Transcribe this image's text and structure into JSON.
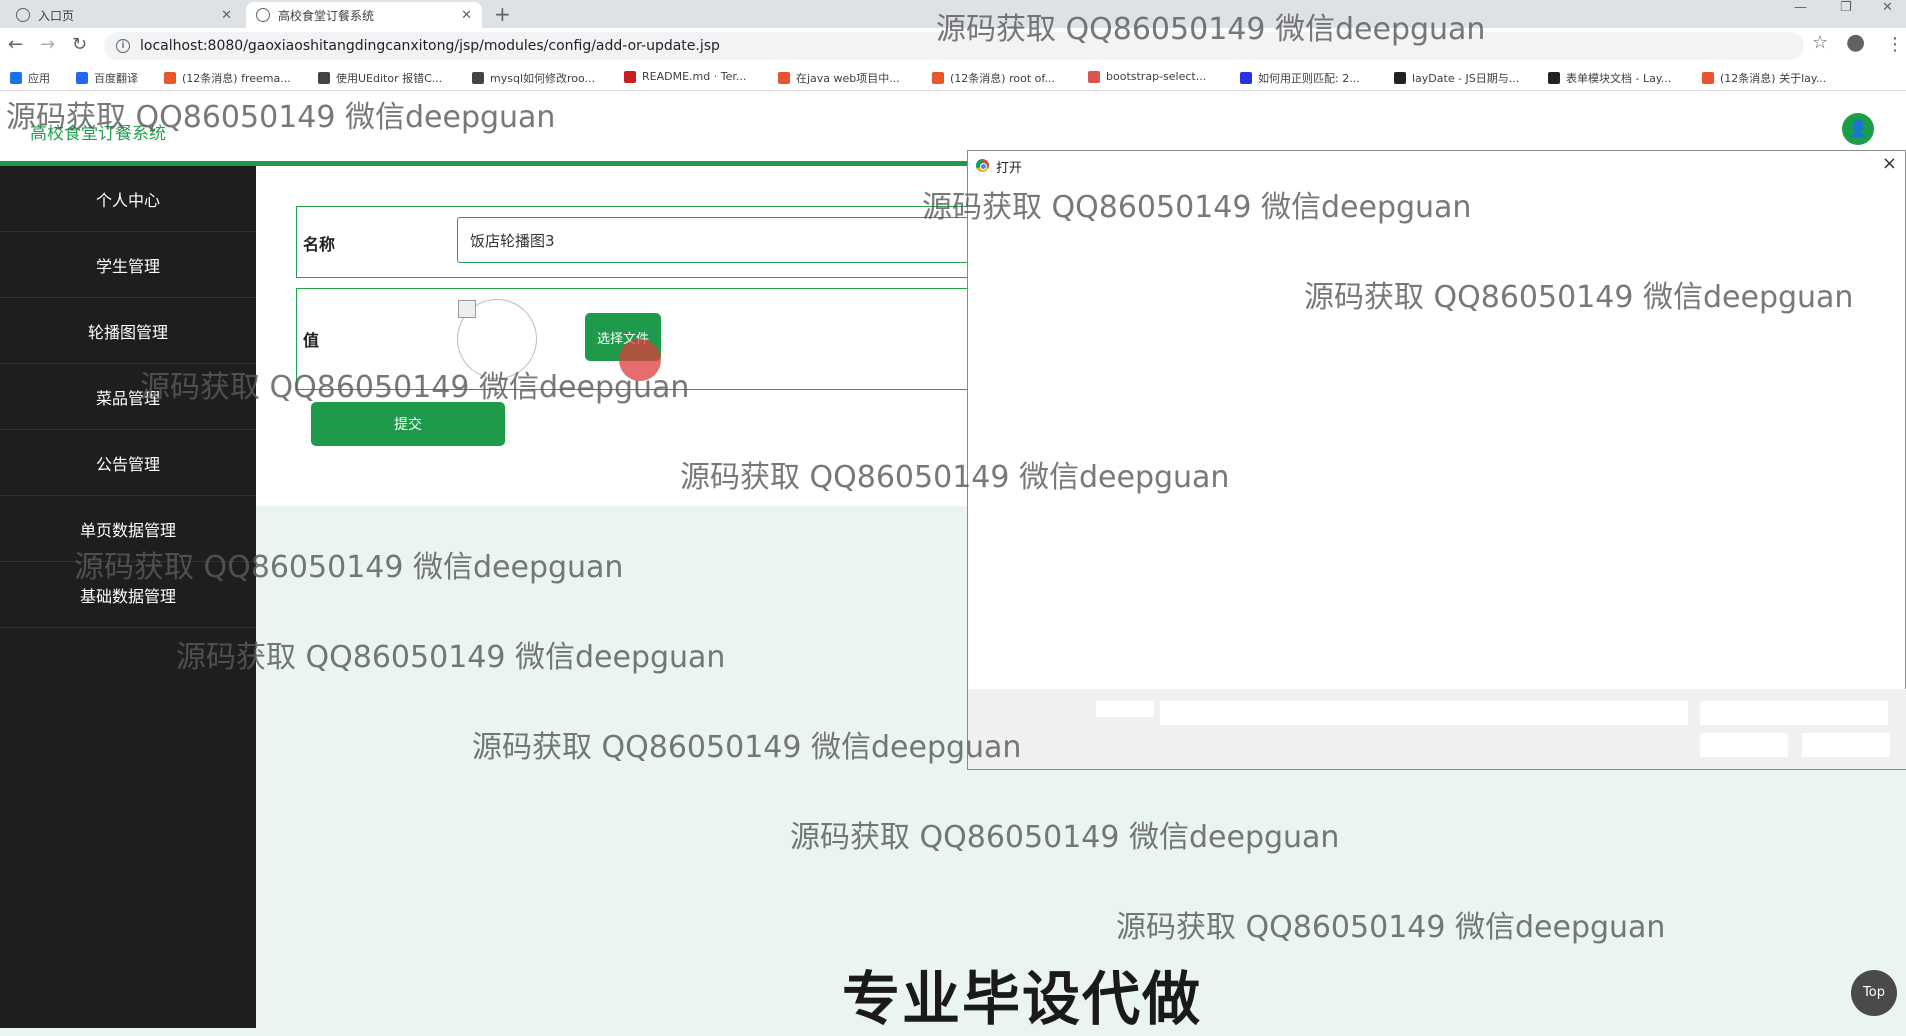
{
  "browser": {
    "tabs": [
      {
        "label": "入口页"
      },
      {
        "label": "高校食堂订餐系统"
      }
    ],
    "url": "localhost:8080/gaoxiaoshitangdingcanxitong/jsp/modules/config/add-or-update.jsp",
    "bookmarks": [
      {
        "label": "应用",
        "color": "#1a73e8"
      },
      {
        "label": "百度翻译",
        "color": "#2468f2"
      },
      {
        "label": "(12条消息) freema...",
        "color": "#e8542c"
      },
      {
        "label": "使用UEditor 报错C...",
        "color": "#444444"
      },
      {
        "label": "mysql如何修改roo...",
        "color": "#444444"
      },
      {
        "label": "README.md · Ter...",
        "color": "#c71d23"
      },
      {
        "label": "在java web项目中...",
        "color": "#e8542c"
      },
      {
        "label": "(12条消息) root of...",
        "color": "#e8542c"
      },
      {
        "label": "bootstrap-select...",
        "color": "#d9534f"
      },
      {
        "label": "如何用正则匹配: 2...",
        "color": "#2932e1"
      },
      {
        "label": "layDate - JS日期与...",
        "color": "#222222"
      },
      {
        "label": "表单模块文档 - Lay...",
        "color": "#222222"
      },
      {
        "label": "(12条消息) 关于lay...",
        "color": "#e8542c"
      }
    ]
  },
  "app": {
    "brand": "高校食堂订餐系统",
    "sidebar": [
      {
        "label": "个人中心"
      },
      {
        "label": "学生管理"
      },
      {
        "label": "轮播图管理"
      },
      {
        "label": "菜品管理"
      },
      {
        "label": "公告管理"
      },
      {
        "label": "单页数据管理"
      },
      {
        "label": "基础数据管理"
      }
    ],
    "form": {
      "name_label": "名称",
      "name_value": "饭店轮播图3",
      "value_label": "值",
      "choose_file": "选择文件",
      "submit": "提交"
    },
    "top_button": "Top"
  },
  "dialog": {
    "title": "打开",
    "close": "×"
  },
  "overlay": {
    "watermark": "源码获取 QQ86050149 微信deepguan",
    "promo": "专业毕设代做"
  },
  "colors": {
    "accent": "#1e9a4a",
    "sidebar_bg": "#1e1e1e",
    "content_bg": "#e9f5ee"
  }
}
